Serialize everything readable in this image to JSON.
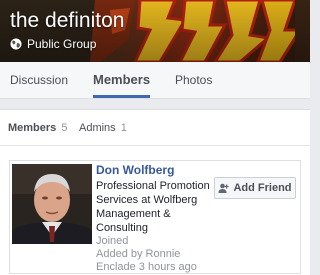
{
  "header": {
    "group_name": "the definiton",
    "privacy_label": "Public Group",
    "privacy_icon": "globe-icon"
  },
  "tabs": [
    {
      "label": "Discussion",
      "active": false
    },
    {
      "label": "Members",
      "active": true
    },
    {
      "label": "Photos",
      "active": false
    }
  ],
  "members_panel": {
    "members_label": "Members",
    "members_count": "5",
    "admins_label": "Admins",
    "admins_count": "1"
  },
  "member_card": {
    "name": "Don Wolfberg",
    "title": "Professional Promotion Services at Wolfberg Management & Consulting",
    "joined": "Joined",
    "added_by": "Added by Ronnie",
    "added_time": "Enclade 3 hours ago",
    "add_friend_label": "Add Friend",
    "add_friend_icon": "add-friend-icon"
  },
  "colors": {
    "link_blue": "#365899",
    "tab_underline": "#4267b2",
    "page_bg": "#e9ebee"
  }
}
